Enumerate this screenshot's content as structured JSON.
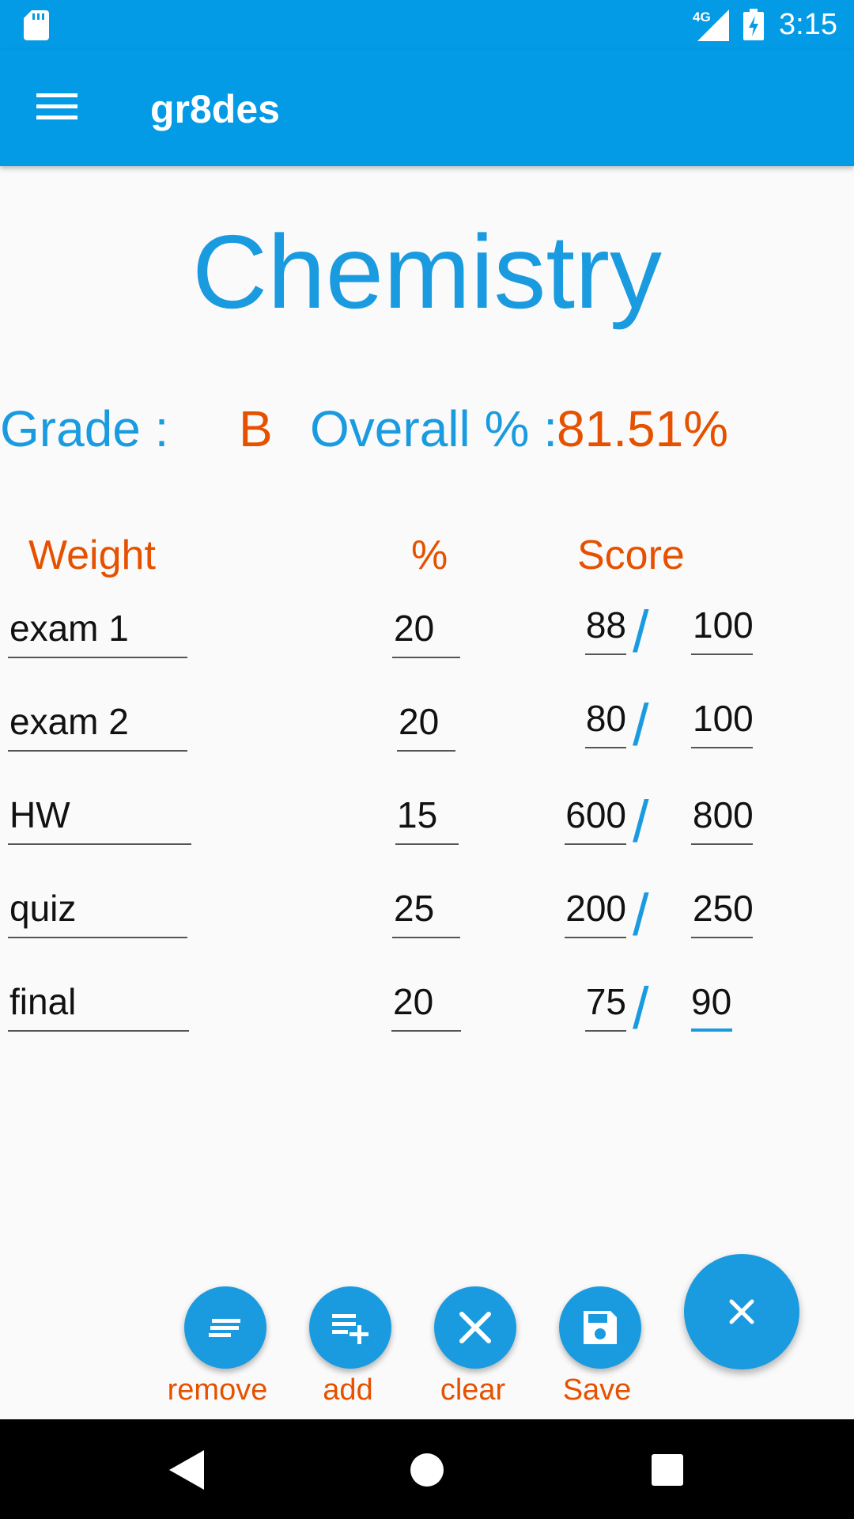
{
  "status_bar": {
    "time": "3:15",
    "network_label": "4G",
    "icons": [
      "sd-card-icon",
      "signal-icon",
      "battery-charging-icon"
    ]
  },
  "app_bar": {
    "title": "gr8des",
    "menu_icon": "menu-icon"
  },
  "subject": "Chemistry",
  "summary": {
    "grade_label": "Grade :",
    "grade_value": "B",
    "overall_label": "Overall % :",
    "overall_value": "81.51%"
  },
  "columns": {
    "weight": "Weight",
    "percent": "%",
    "score": "Score"
  },
  "rows": [
    {
      "name": "exam 1",
      "percent": "20",
      "score": "88",
      "total": "100"
    },
    {
      "name": "exam 2",
      "percent": "20",
      "score": "80",
      "total": "100"
    },
    {
      "name": "HW",
      "percent": "15",
      "score": "600",
      "total": "800"
    },
    {
      "name": "quiz",
      "percent": "25",
      "score": "200",
      "total": "250"
    },
    {
      "name": "final",
      "percent": "20",
      "score": "75",
      "total": "90"
    }
  ],
  "slash": "/",
  "actions": [
    {
      "label": "remove",
      "icon": "remove-list-icon"
    },
    {
      "label": "add",
      "icon": "add-list-icon"
    },
    {
      "label": "clear",
      "icon": "close-icon"
    },
    {
      "label": "Save",
      "icon": "save-icon"
    }
  ],
  "main_fab_icon": "close-icon",
  "colors": {
    "primary": "#039be5",
    "accent_blue": "#1a9be0",
    "accent_orange": "#e65100",
    "background": "#fafafa"
  }
}
